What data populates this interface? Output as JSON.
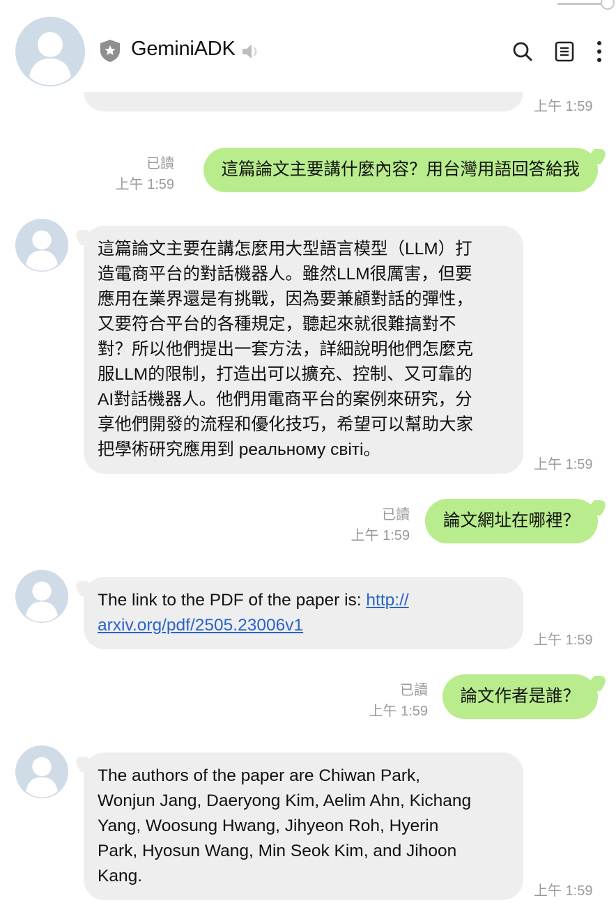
{
  "header": {
    "title": "GeminiADK",
    "icons": [
      "shield-icon",
      "speaker-icon",
      "search-icon",
      "notes-icon",
      "more-vertical-icon"
    ]
  },
  "messages": [
    {
      "id": "m0",
      "side": "in",
      "partial": true,
      "time": "上午 1:59"
    },
    {
      "id": "m1",
      "side": "out",
      "text": "這篇論文主要講什麼內容？用台灣用語回答給我",
      "read": "已讀",
      "time": "上午 1:59"
    },
    {
      "id": "m2",
      "side": "in",
      "lines": [
        "這篇論文主要在講怎麼用大型語言模型（LLM）打",
        "造電商平台的對話機器人。雖然LLM很厲害，但要",
        "應用在業界還是有挑戰，因為要兼顧對話的彈性，",
        "又要符合平台的各種規定，聽起來就很難搞對不",
        "對？所以他們提出一套方法，詳細說明他們怎麼克",
        "服LLM的限制，打造出可以擴充、控制、又可靠的",
        "AI對話機器人。他們用電商平台的案例來研究，分",
        "享他們開發的流程和優化技巧，希望可以幫助大家",
        "把學術研究應用到 реальному світі。"
      ],
      "time": "上午 1:59"
    },
    {
      "id": "m3",
      "side": "out",
      "text": "論文網址在哪裡？",
      "read": "已讀",
      "time": "上午 1:59"
    },
    {
      "id": "m4",
      "side": "in",
      "prefix": "The link to the PDF of the paper is: ",
      "link_line1": "http://",
      "link_line2": "arxiv.org/pdf/2505.23006v1",
      "time": "上午 1:59"
    },
    {
      "id": "m5",
      "side": "out",
      "text": "論文作者是誰？",
      "read": "已讀",
      "time": "上午 1:59"
    },
    {
      "id": "m6",
      "side": "in",
      "lines": [
        "The authors of the paper are Chiwan Park,",
        "Wonjun Jang, Daeryong Kim, Aelim Ahn, Kichang",
        "Yang, Woosung Hwang, Jihyeon Roh, Hyerin",
        "Park, Hyosun Wang, Min Seok Kim, and Jihoon",
        "Kang."
      ],
      "time": "上午 1:59"
    }
  ],
  "colors": {
    "incoming_bubble": "#eeeeee",
    "outgoing_bubble": "#b8ec8c",
    "link": "#2a63c8",
    "meta_text": "#9a9a9a",
    "avatar": "#cfdce7"
  }
}
